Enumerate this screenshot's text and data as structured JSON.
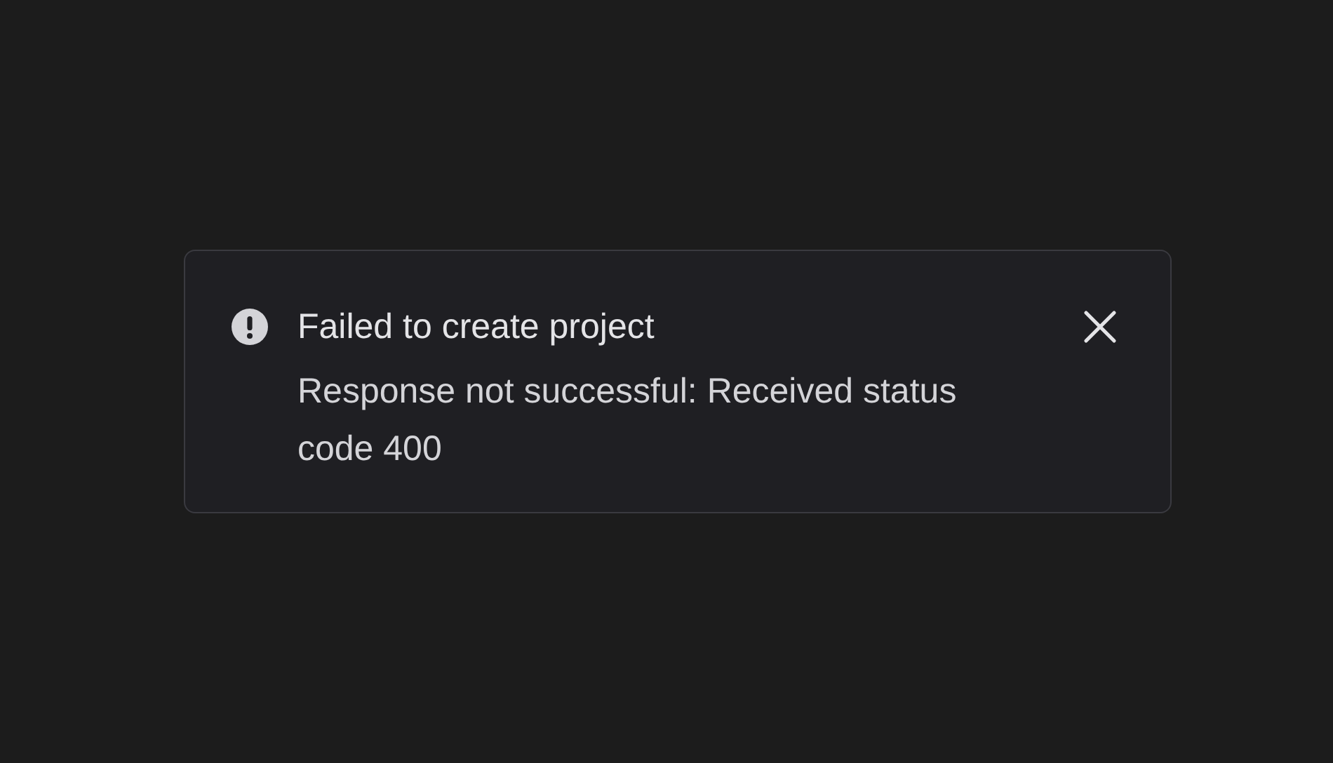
{
  "toast": {
    "kind": "error",
    "title": "Failed to create project",
    "message": "Response not successful: Received status code 400"
  }
}
